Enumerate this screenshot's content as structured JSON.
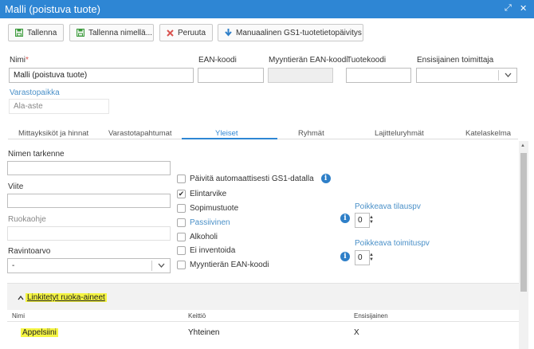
{
  "window": {
    "title": "Malli (poistuva tuote)"
  },
  "toolbar": {
    "save_label": "Tallenna",
    "save_as_label": "Tallenna nimellä...",
    "cancel_label": "Peruuta",
    "gs1_update_label": "Manuaalinen GS1-tuotetietopäivitys"
  },
  "form": {
    "name_label": "Nimi",
    "name_required": "*",
    "name_value": "Malli (poistuva tuote)",
    "ean_label": "EAN-koodi",
    "ean_value": "",
    "batch_ean_label": "Myyntierän EAN-koodi",
    "batch_ean_value": "",
    "product_code_label": "Tuotekoodi",
    "product_code_value": "",
    "primary_supplier_label": "Ensisijainen toimittaja",
    "primary_supplier_value": "",
    "storage_label": "Varastopaikka",
    "storage_value": "Ala-aste"
  },
  "tabs": [
    {
      "label": "Mittayksiköt ja hinnat"
    },
    {
      "label": "Varastotapahtumat"
    },
    {
      "label": "Yleiset"
    },
    {
      "label": "Ryhmät"
    },
    {
      "label": "Lajitteluryhmät"
    },
    {
      "label": "Katelaskelma"
    }
  ],
  "general": {
    "name_spec_label": "Nimen tarkenne",
    "name_spec_value": "",
    "reference_label": "Viite",
    "reference_value": "",
    "food_instruction_label": "Ruokaohje",
    "food_instruction_value": "",
    "nutrition_label": "Ravintoarvo",
    "nutrition_value": "-",
    "checkboxes": [
      {
        "label": "Päivitä automaattisesti GS1-datalla",
        "checked": false
      },
      {
        "label": "Elintarvike",
        "checked": true
      },
      {
        "label": "Sopimustuote",
        "checked": false
      },
      {
        "label": "Passiivinen",
        "checked": false
      },
      {
        "label": "Alkoholi",
        "checked": false
      },
      {
        "label": "Ei inventoida",
        "checked": false
      },
      {
        "label": "Myyntierän EAN-koodi",
        "checked": false
      }
    ],
    "order_days_label": "Poikkeava tilauspv",
    "order_days_value": "0",
    "delivery_days_label": "Poikkeava toimituspv",
    "delivery_days_value": "0"
  },
  "linked_foods": {
    "title": "Linkitetyt ruoka-aineet",
    "columns": [
      "Nimi",
      "Keittiö",
      "Ensisijainen"
    ],
    "rows": [
      {
        "name": "Appelsiini",
        "kitchen": "Yhteinen",
        "primary": "X"
      }
    ]
  },
  "colors": {
    "titlebar": "#2e86d4",
    "accent": "#2e86d4",
    "highlight": "#f5f543",
    "cancel_icon": "#d9534f",
    "save_icon": "#3a9a3a",
    "info_icon": "#2e7fc8"
  }
}
